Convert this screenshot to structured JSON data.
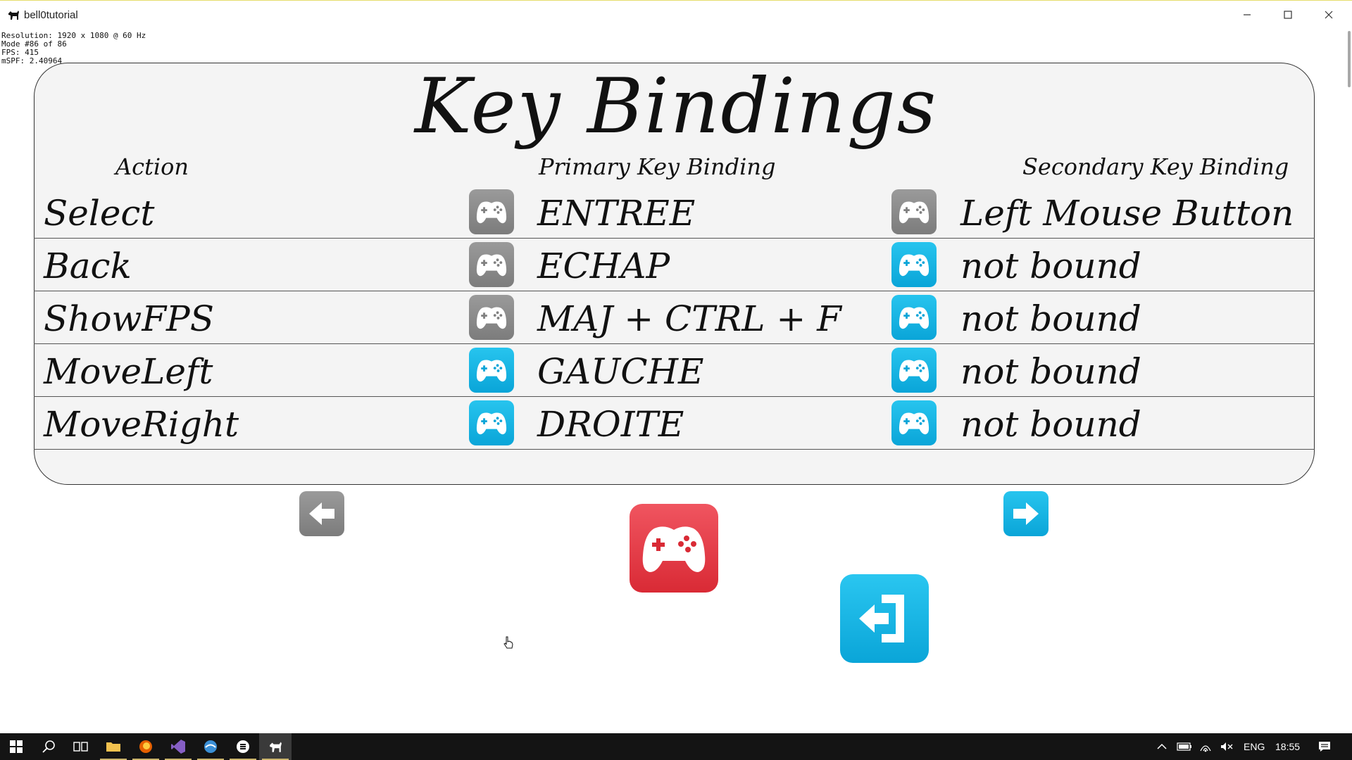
{
  "window": {
    "title": "bell0tutorial",
    "minimize_icon": "minimize-icon",
    "maximize_icon": "maximize-icon",
    "close_icon": "close-icon"
  },
  "debug": {
    "resolution": "Resolution: 1920 x 1080 @ 60 Hz",
    "mode": "Mode #86 of 86",
    "fps": "FPS: 415",
    "mspf": "mSPF: 2.40964"
  },
  "screen": {
    "title": "Key Bindings",
    "columns": {
      "action": "Action",
      "primary": "Primary Key Binding",
      "secondary": "Secondary Key Binding"
    },
    "rows": [
      {
        "action": "Select",
        "primary": "ENTREE",
        "secondary": "Left Mouse Button",
        "primary_pad": "gray",
        "secondary_pad": "gray"
      },
      {
        "action": "Back",
        "primary": "ECHAP",
        "secondary": "not bound",
        "primary_pad": "gray",
        "secondary_pad": "blue"
      },
      {
        "action": "ShowFPS",
        "primary": "MAJ + CTRL + F",
        "secondary": "not bound",
        "primary_pad": "gray",
        "secondary_pad": "blue"
      },
      {
        "action": "MoveLeft",
        "primary": "GAUCHE",
        "secondary": "not bound",
        "primary_pad": "blue",
        "secondary_pad": "blue"
      },
      {
        "action": "MoveRight",
        "primary": "DROITE",
        "secondary": "not bound",
        "primary_pad": "blue",
        "secondary_pad": "blue"
      }
    ]
  },
  "buttons": {
    "prev_page": {
      "icon": "arrow-left-icon",
      "color": "#8a8a8a"
    },
    "next_page": {
      "icon": "arrow-right-icon",
      "color": "#18b4e6"
    },
    "gamepad_mode": {
      "icon": "gamepad-icon",
      "color": "#e0303c"
    },
    "exit": {
      "icon": "exit-icon",
      "color": "#18b4e6"
    }
  },
  "taskbar": {
    "icons": [
      "windows-start-icon",
      "search-icon",
      "task-view-icon",
      "file-explorer-icon",
      "firefox-icon",
      "visual-studio-icon",
      "browser-icon",
      "media-player-icon",
      "bell0tutorial-app-icon"
    ],
    "tray": {
      "language": "ENG",
      "time": "18:55"
    }
  },
  "colors": {
    "pad_gray": "#8a8a8a",
    "pad_blue": "#18b4e6",
    "accent_red": "#e0303c"
  }
}
